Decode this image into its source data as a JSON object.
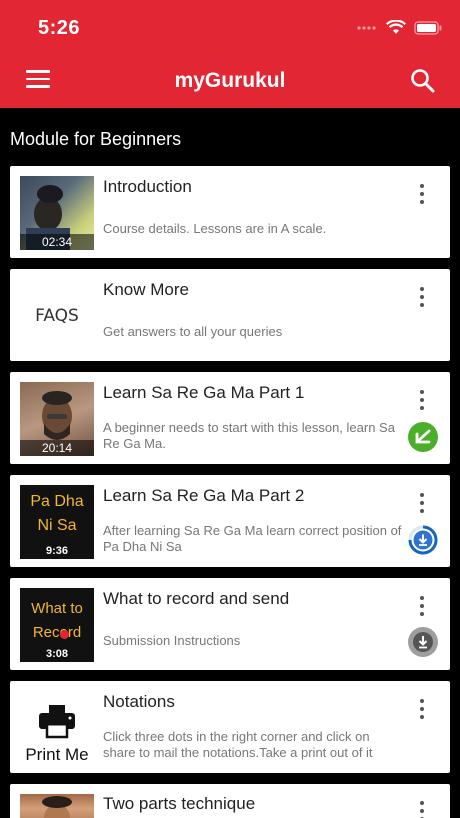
{
  "status_bar": {
    "time": "5:26"
  },
  "app_bar": {
    "title": "myGurukul"
  },
  "section": {
    "title": "Module for Beginners"
  },
  "lessons": [
    {
      "title": "Introduction",
      "description": "Course details. Lessons are in A scale.",
      "duration": "02:34"
    },
    {
      "title": "Know More",
      "description": "Get answers to all your queries",
      "thumb_text": "FAQS"
    },
    {
      "title": "Learn Sa Re Ga Ma Part 1",
      "description": "A beginner needs to start with this lesson, learn Sa Re Ga Ma.",
      "duration": "20:14",
      "status": "downloaded"
    },
    {
      "title": "Learn Sa Re Ga Ma Part 2",
      "description": "After learning Sa Re Ga Ma learn correct position of Pa Dha Ni Sa",
      "duration": "9:36",
      "thumb_line1": "Pa Dha",
      "thumb_line2": "Ni Sa",
      "status": "downloading"
    },
    {
      "title": "What to record and send",
      "description": "Submission Instructions",
      "duration": "3:08",
      "thumb_line1": "What to",
      "thumb_line2": "Record",
      "status": "download"
    },
    {
      "title": "Notations",
      "description": "Click three dots in the right corner and click on share to mail the notations.Take a print out of it",
      "thumb_text": "Print Me"
    },
    {
      "title": "Two parts technique"
    }
  ],
  "colors": {
    "brand": "#e32633",
    "downloaded": "#4caf2a",
    "downloading": "#1565c0",
    "download": "#9e9e9e"
  }
}
